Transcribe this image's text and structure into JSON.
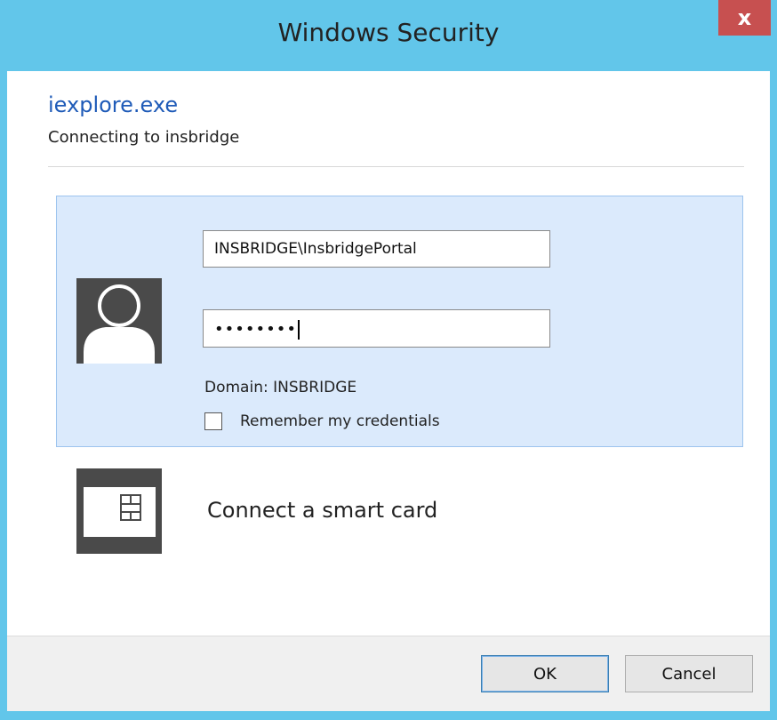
{
  "window": {
    "title": "Windows Security",
    "close_label": "x"
  },
  "header": {
    "app_name": "iexplore.exe",
    "subtitle": "Connecting to insbridge"
  },
  "credential_tile": {
    "username_value": "INSBRIDGE\\InsbridgePortal",
    "password_mask": "••••••••",
    "domain_text": "Domain: INSBRIDGE",
    "remember_label": "Remember my credentials",
    "remember_checked": false
  },
  "smartcard": {
    "label": "Connect a smart card"
  },
  "footer": {
    "ok_label": "OK",
    "cancel_label": "Cancel"
  },
  "colors": {
    "window_frame": "#62c6ea",
    "title_close": "#c75050",
    "app_name": "#1f5bb8",
    "tile_background": "#dbeafc",
    "tile_border": "#9dc4ee"
  },
  "icons": {
    "avatar": "user-avatar-icon",
    "smartcard": "smart-card-icon"
  }
}
